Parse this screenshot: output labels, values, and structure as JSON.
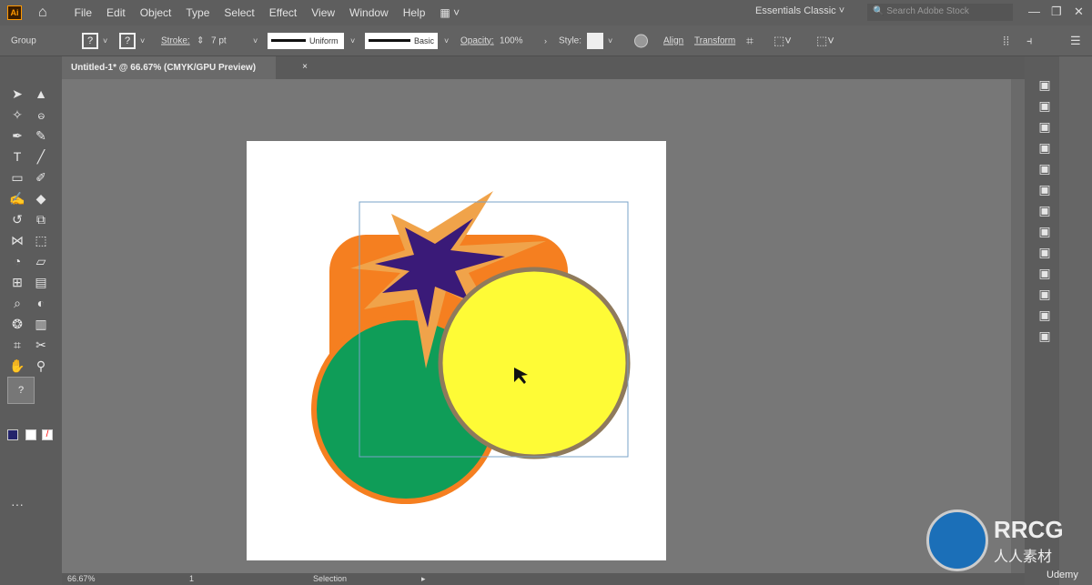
{
  "app": {
    "logo": "Ai",
    "home_icon": "home-icon"
  },
  "menu": [
    "File",
    "Edit",
    "Object",
    "Type",
    "Select",
    "Effect",
    "View",
    "Window",
    "Help"
  ],
  "workspace": "Essentials Classic",
  "search_placeholder": "Search Adobe Stock",
  "control": {
    "selection_type": "Group",
    "fill": "?",
    "stroke_swatch": "?",
    "stroke_label": "Stroke:",
    "stroke_weight": "7 pt",
    "profile": "Uniform",
    "brush": "Basic",
    "opacity_label": "Opacity:",
    "opacity": "100%",
    "style_label": "Style:",
    "align": "Align",
    "transform": "Transform"
  },
  "document_tab": {
    "title": "Untitled-1* @ 66.67% (CMYK/GPU Preview)",
    "close": "×"
  },
  "tools": [
    "selection",
    "direct-selection",
    "magic-wand",
    "lasso",
    "pen",
    "curvature",
    "type",
    "line",
    "rectangle",
    "paintbrush",
    "shaper",
    "eraser",
    "rotate",
    "scale",
    "width",
    "free-transform",
    "shape-builder",
    "perspective",
    "mesh",
    "gradient",
    "eyedropper",
    "blend",
    "symbol-sprayer",
    "column-graph",
    "artboard",
    "slice",
    "hand",
    "zoom"
  ],
  "status": {
    "zoom": "66.67%",
    "artboard": "1",
    "tool": "Selection"
  },
  "watermark": {
    "brand": "RRCG",
    "sub": "人人素材",
    "udemy": "Udemy"
  },
  "colors": {
    "orange": "#f57f20",
    "green": "#0f9d58",
    "yellow": "#fefb36",
    "purple": "#3a1a78",
    "star_outline": "#f0a34a",
    "yellow_stroke": "#8f7a5c"
  }
}
